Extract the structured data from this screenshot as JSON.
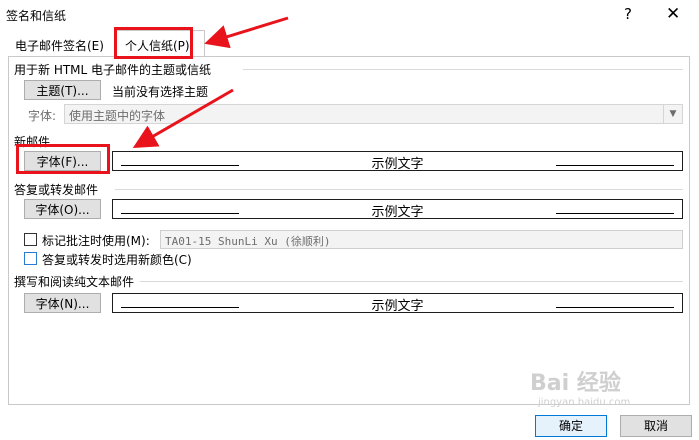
{
  "window": {
    "title": "签名和信纸",
    "help_label": "?",
    "close_label": "✕"
  },
  "tabs": [
    {
      "label": "电子邮件签名(E)"
    },
    {
      "label": "个人信纸(P)"
    }
  ],
  "theme": {
    "section": "用于新 HTML 电子邮件的主题或信纸",
    "button": "主题(T)...",
    "status": "当前没有选择主题",
    "font_label": "字体:",
    "font_value": "使用主题中的字体"
  },
  "new_mail": {
    "section": "新邮件",
    "button": "字体(F)...",
    "sample": "示例文字"
  },
  "reply": {
    "section": "答复或转发邮件",
    "button": "字体(O)...",
    "sample": "示例文字",
    "mark_label": "标记批注时使用(M):",
    "mark_value": "TA01-15 ShunLi Xu (徐顺利)",
    "color_label": "答复或转发时选用新颜色(C)"
  },
  "plain": {
    "section": "撰写和阅读纯文本邮件",
    "button": "字体(N)...",
    "sample": "示例文字"
  },
  "footer": {
    "ok": "确定",
    "cancel": "取消"
  },
  "watermark": {
    "text": "Bai 经验",
    "sub": "jingyan.baidu.com"
  },
  "colors": {
    "annotation": "#e8131b",
    "ok_border": "#0078d7"
  }
}
